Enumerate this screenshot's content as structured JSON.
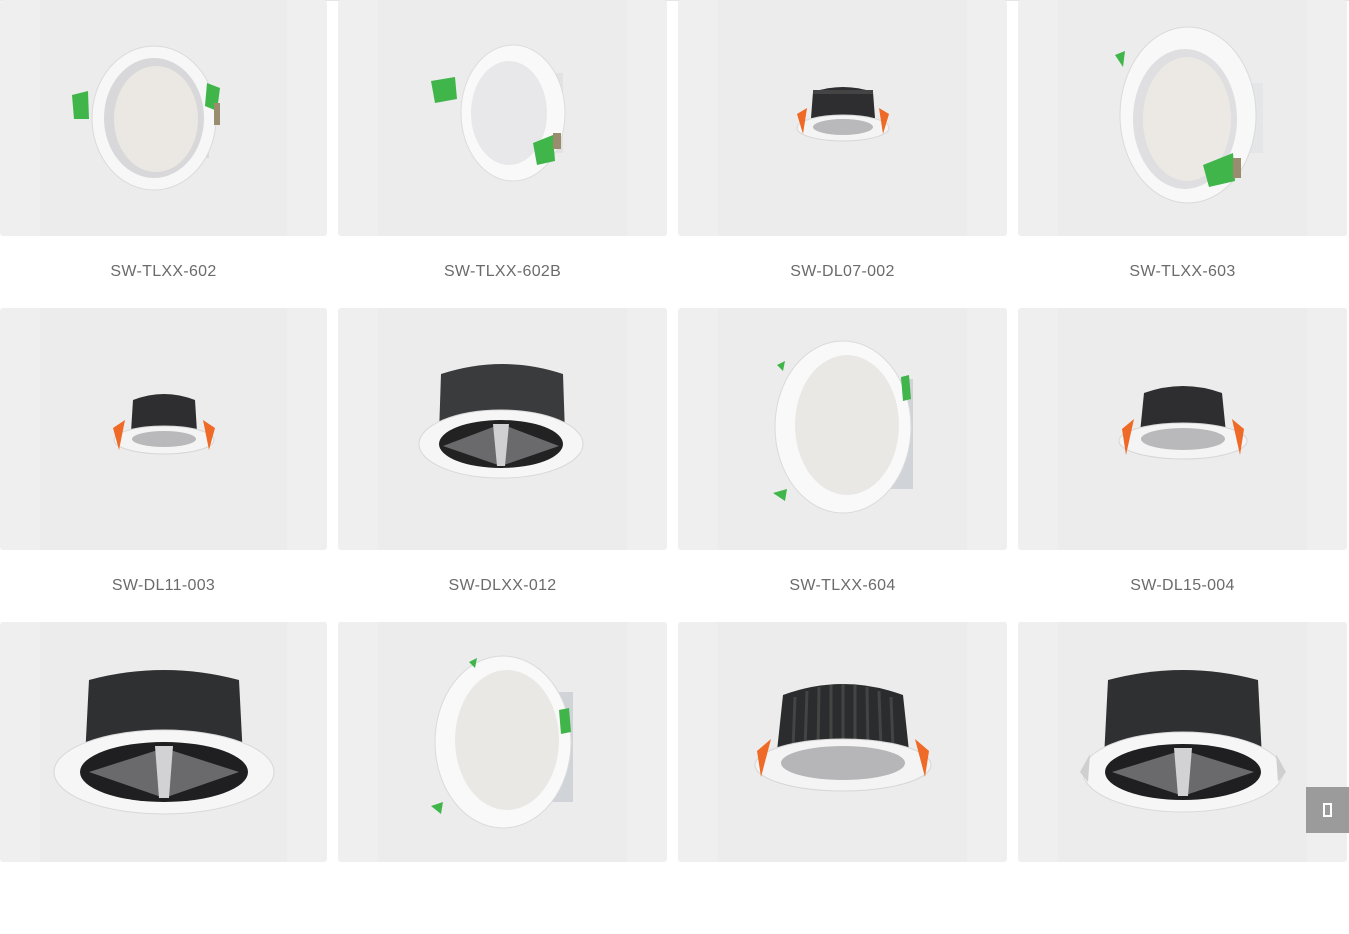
{
  "products": [
    {
      "model": "SW-TLXX-602",
      "style": "panel-green"
    },
    {
      "model": "SW-TLXX-602B",
      "style": "panel-green-b"
    },
    {
      "model": "SW-DL07-002",
      "style": "cob-small"
    },
    {
      "model": "SW-TLXX-603",
      "style": "panel-large"
    },
    {
      "model": "SW-DL11-003",
      "style": "cob-small"
    },
    {
      "model": "SW-DLXX-012",
      "style": "cob-reflector"
    },
    {
      "model": "SW-TLXX-604",
      "style": "panel-tilted"
    },
    {
      "model": "SW-DL15-004",
      "style": "cob-medium"
    },
    {
      "model": "",
      "style": "cob-reflector-large"
    },
    {
      "model": "",
      "style": "panel-tilted"
    },
    {
      "model": "",
      "style": "cob-finned"
    },
    {
      "model": "",
      "style": "cob-reflector-large"
    }
  ],
  "scroll_top": {
    "icon": "scroll-to-top-icon"
  }
}
